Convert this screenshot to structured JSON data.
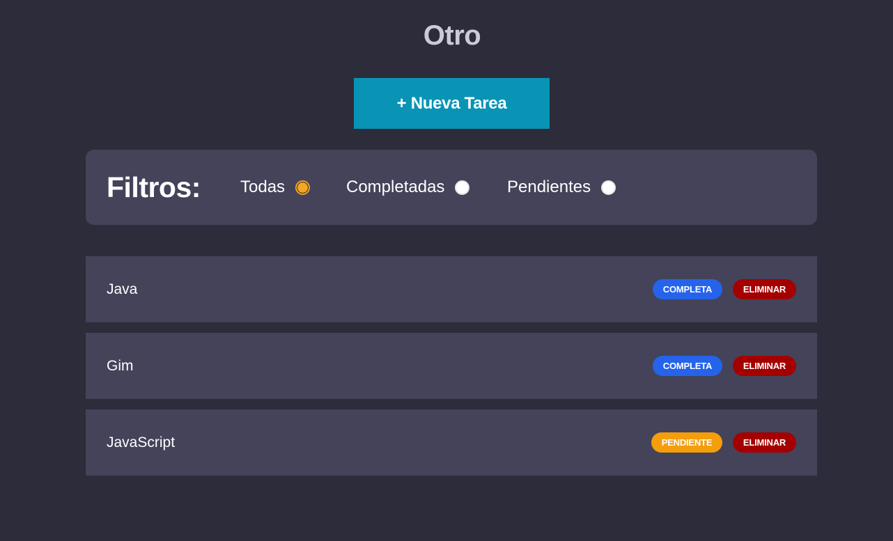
{
  "header": {
    "title": "Otro",
    "new_task_label": "+ Nueva Tarea"
  },
  "filters": {
    "heading": "Filtros:",
    "options": [
      {
        "label": "Todas",
        "checked": true
      },
      {
        "label": "Completadas",
        "checked": false
      },
      {
        "label": "Pendientes",
        "checked": false
      }
    ]
  },
  "tasks": [
    {
      "name": "Java",
      "status_label": "COMPLETA",
      "status": "complete",
      "delete_label": "ELIMINAR"
    },
    {
      "name": "Gim",
      "status_label": "COMPLETA",
      "status": "complete",
      "delete_label": "ELIMINAR"
    },
    {
      "name": "JavaScript",
      "status_label": "PENDIENTE",
      "status": "pending",
      "delete_label": "ELIMINAR"
    }
  ],
  "colors": {
    "background": "#2d2c3b",
    "panel": "#44435a",
    "accent_button": "#0994b6",
    "complete": "#2563eb",
    "pending": "#f59e0b",
    "delete": "#a50000",
    "radio_checked": "#f5a623"
  },
  "icons": {
    "radio_checked": "radio-checked-icon",
    "radio_unchecked": "radio-unchecked-icon"
  }
}
